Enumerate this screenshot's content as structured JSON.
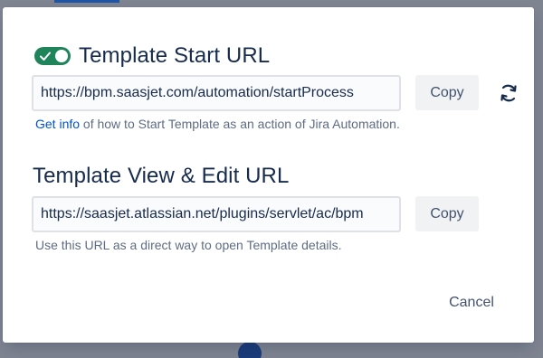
{
  "colors": {
    "accent_toggle": "#1f845a",
    "link": "#0052cc",
    "text_primary": "#172b4d",
    "text_secondary": "#5e6c84",
    "overlay": "#7f8491"
  },
  "start_section": {
    "toggle_on": true,
    "title": "Template Start URL",
    "url_value": "https://bpm.saasjet.com/automation/startProcess",
    "copy_label": "Copy",
    "refresh_icon": "refresh-icon",
    "help_link": "Get info",
    "help_text": " of how to Start Template as an action of Jira Automation."
  },
  "view_section": {
    "title": "Template View & Edit URL",
    "url_value": "https://saasjet.atlassian.net/plugins/servlet/ac/bpm",
    "copy_label": "Copy",
    "help_text": "Use this URL as a direct way to open Template details."
  },
  "footer": {
    "cancel_label": "Cancel"
  }
}
